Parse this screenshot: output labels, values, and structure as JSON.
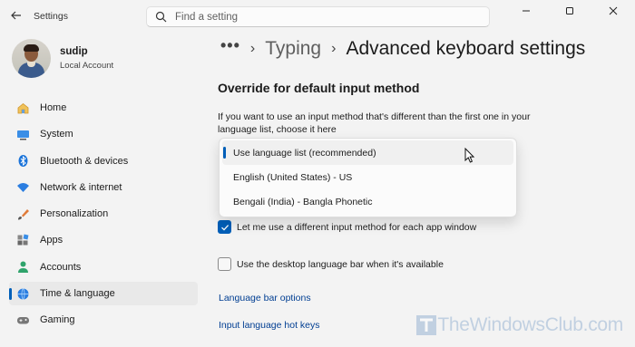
{
  "window": {
    "app_title": "Settings"
  },
  "search": {
    "placeholder": "Find a setting"
  },
  "profile": {
    "name": "sudip",
    "account_type": "Local Account"
  },
  "sidebar": {
    "items": [
      {
        "label": "Home",
        "icon": "home-icon"
      },
      {
        "label": "System",
        "icon": "monitor-icon"
      },
      {
        "label": "Bluetooth & devices",
        "icon": "bluetooth-icon"
      },
      {
        "label": "Network & internet",
        "icon": "wifi-icon"
      },
      {
        "label": "Personalization",
        "icon": "brush-icon"
      },
      {
        "label": "Apps",
        "icon": "apps-icon"
      },
      {
        "label": "Accounts",
        "icon": "person-icon"
      },
      {
        "label": "Time & language",
        "icon": "globe-clock-icon",
        "active": true
      },
      {
        "label": "Gaming",
        "icon": "gamepad-icon"
      }
    ]
  },
  "breadcrumb": {
    "more": "•••",
    "parent": "Typing",
    "current": "Advanced keyboard settings"
  },
  "main": {
    "section_title": "Override for default input method",
    "description": "If you want to use an input method that's different than the first one in your language list, choose it here",
    "dropdown": {
      "options": [
        "Use language list (recommended)",
        "English (United States) - US",
        "Bengali (India) - Bangla Phonetic"
      ],
      "selected": "Use language list (recommended)"
    },
    "checkbox_per_app": {
      "label": "Let me use a different input method for each app window",
      "checked": true
    },
    "checkbox_desktop_bar": {
      "label": "Use the desktop language bar when it's available",
      "checked": false
    },
    "link_language_bar": "Language bar options",
    "link_hot_keys": "Input language hot keys"
  },
  "watermark": {
    "text": "TheWindowsClub.com"
  },
  "colors": {
    "accent": "#005fb8",
    "link": "#003e92",
    "background": "#f3f3f3"
  }
}
